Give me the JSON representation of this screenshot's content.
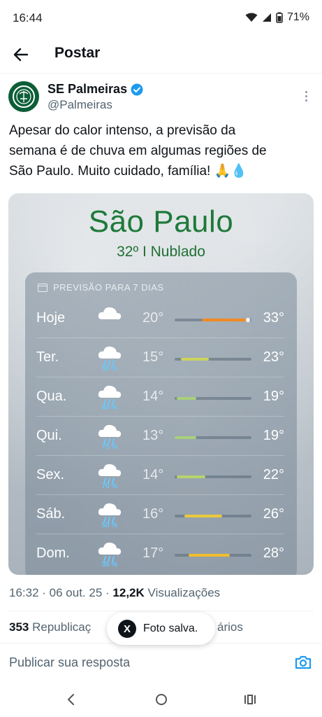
{
  "status_bar": {
    "time": "16:44",
    "battery": "71%"
  },
  "appbar": {
    "title": "Postar"
  },
  "author": {
    "name": "SE Palmeiras",
    "handle": "@Palmeiras"
  },
  "tweet": {
    "lines": [
      "Apesar do calor intenso, a previsão da",
      "semana é de chuva em algumas regiões de",
      "São Paulo. Muito cuidado, família! 🙏💧"
    ]
  },
  "weather": {
    "city": "São Paulo",
    "current": "32º  I  Nublado",
    "forecast_title": "PREVISÃO PARA 7 DIAS",
    "days": [
      {
        "day": "Hoje",
        "low": "20°",
        "high": "33°",
        "icon": "cloud-icon",
        "rain": "",
        "bar_start": 0.35,
        "bar_end": 0.95,
        "color": "#f08a24",
        "dot": true
      },
      {
        "day": "Ter.",
        "low": "15°",
        "high": "23°",
        "icon": "rain-cloud-icon",
        "rain": "55 %",
        "bar_start": 0.08,
        "bar_end": 0.45,
        "color": "#cdd45a",
        "dot": false
      },
      {
        "day": "Qua.",
        "low": "14°",
        "high": "19°",
        "icon": "rain-cloud-icon",
        "rain": "80 %",
        "bar_start": 0.03,
        "bar_end": 0.28,
        "color": "#a8d07a",
        "dot": false
      },
      {
        "day": "Qui.",
        "low": "13°",
        "high": "19°",
        "icon": "rain-cloud-icon",
        "rain": "75 %",
        "bar_start": 0.0,
        "bar_end": 0.28,
        "color": "#a8d07a",
        "dot": false
      },
      {
        "day": "Sex.",
        "low": "14°",
        "high": "22°",
        "icon": "rain-cloud-icon",
        "rain": "70 %",
        "bar_start": 0.03,
        "bar_end": 0.4,
        "color": "#b6d36c",
        "dot": false
      },
      {
        "day": "Sáb.",
        "low": "16°",
        "high": "26°",
        "icon": "rain-cloud-icon",
        "rain": "50 %",
        "bar_start": 0.13,
        "bar_end": 0.62,
        "color": "#e8c93a",
        "dot": false
      },
      {
        "day": "Dom.",
        "low": "17°",
        "high": "28°",
        "icon": "rain-cloud-icon",
        "rain": "35 %",
        "bar_start": 0.18,
        "bar_end": 0.72,
        "color": "#f0be2c",
        "dot": false
      }
    ]
  },
  "meta": {
    "time": "16:32",
    "date": "06 out. 25",
    "views_count": "12,2K",
    "views_label": "Visualizações"
  },
  "stats": {
    "reposts_count": "353",
    "reposts_label": "Republicaç",
    "likes_tail": "ários"
  },
  "toast": {
    "logo": "X",
    "text": "Foto salva."
  },
  "reply": {
    "placeholder": "Publicar sua resposta"
  },
  "colors": {
    "palmeiras_green": "#0c5e36",
    "verified_blue": "#1d9bf0",
    "link_blue": "#1d9bf0"
  }
}
